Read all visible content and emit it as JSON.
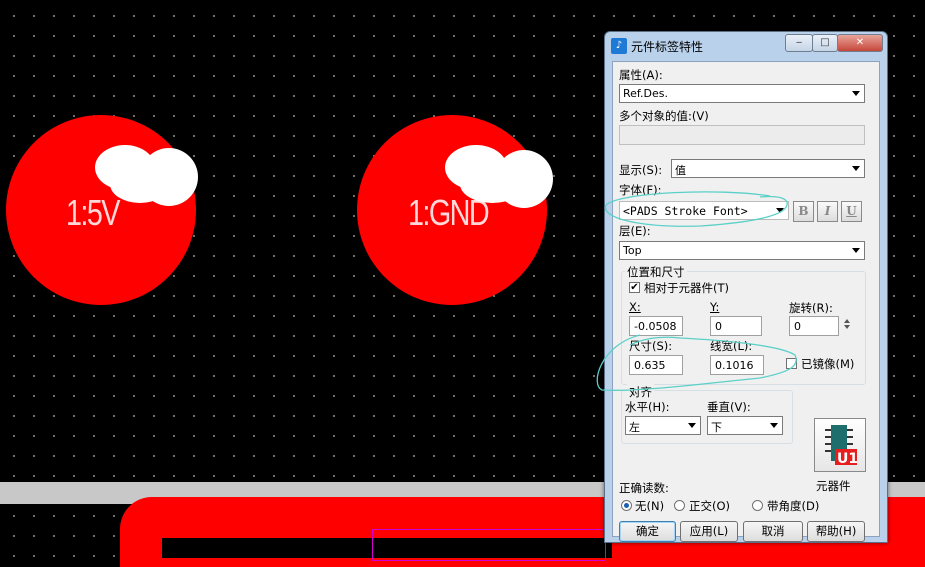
{
  "canvas": {
    "pads": [
      {
        "label": "1:5V"
      },
      {
        "label": "1:GND"
      }
    ]
  },
  "dialog": {
    "title": "元件标签特性",
    "title_icon": "part-label-icon",
    "attribute": {
      "label": "属性(A):",
      "value": "Ref.Des."
    },
    "multi_value": {
      "label": "多个对象的值:(V)",
      "value": ""
    },
    "display": {
      "label": "显示(S):",
      "value": "值"
    },
    "font": {
      "label": "字体(F):",
      "value": "<PADS Stroke Font>",
      "bold": "B",
      "italic": "I",
      "underline": "U"
    },
    "layer": {
      "label": "层(E):",
      "value": "Top"
    },
    "position_size": {
      "group_title": "位置和尺寸",
      "relative_to_part": {
        "label": "相对于元器件(T)",
        "checked": true
      },
      "x": {
        "label": "X:",
        "value": "-0.0508"
      },
      "y": {
        "label": "Y:",
        "value": "0"
      },
      "rotation": {
        "label": "旋转(R):",
        "value": "0"
      },
      "size": {
        "label": "尺寸(S):",
        "value": "0.635"
      },
      "line_width": {
        "label": "线宽(L):",
        "value": "0.1016"
      },
      "mirror": {
        "label": "已镜像(M)",
        "checked": false
      }
    },
    "alignment": {
      "group_title": "对齐",
      "horizontal": {
        "label": "水平(H):",
        "value": "左"
      },
      "vertical": {
        "label": "垂直(V):",
        "value": "下"
      }
    },
    "component": {
      "label": "元器件",
      "icon": "component-u1-icon"
    },
    "right_reading": {
      "label": "正确读数:",
      "options": [
        "无(N)",
        "正交(O)",
        "带角度(D)"
      ],
      "selected": "无(N)"
    },
    "buttons": {
      "ok": "确定",
      "apply": "应用(L)",
      "cancel": "取消",
      "help": "帮助(H)"
    }
  }
}
